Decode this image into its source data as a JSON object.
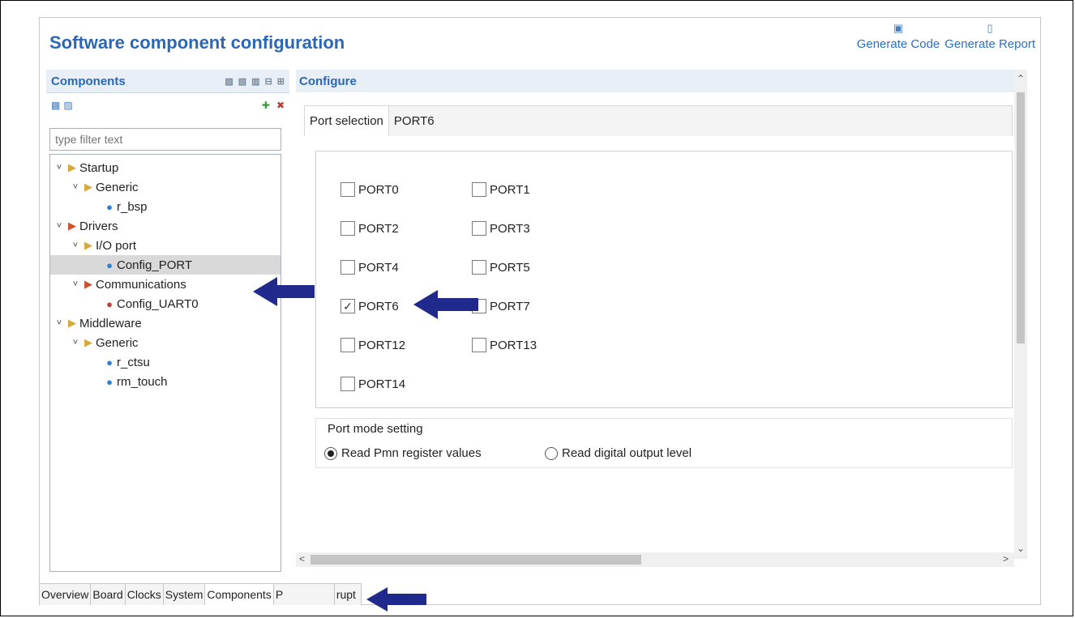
{
  "window": {
    "title": "Software component configuration"
  },
  "header_actions": [
    {
      "label": "Generate Code",
      "icon": "generate-code-icon"
    },
    {
      "label": "Generate Report",
      "icon": "generate-report-icon"
    }
  ],
  "components_panel": {
    "title": "Components",
    "filter_placeholder": "type filter text",
    "tree": [
      {
        "label": "Startup",
        "level": 0,
        "type": "folder"
      },
      {
        "label": "Generic",
        "level": 1,
        "type": "folder"
      },
      {
        "label": "r_bsp",
        "level": 2,
        "type": "component"
      },
      {
        "label": "Drivers",
        "level": 0,
        "type": "folder"
      },
      {
        "label": "I/O port",
        "level": 1,
        "type": "folder"
      },
      {
        "label": "Config_PORT",
        "level": 2,
        "type": "component",
        "selected": true
      },
      {
        "label": "Communications",
        "level": 1,
        "type": "folder"
      },
      {
        "label": "Config_UART0",
        "level": 2,
        "type": "component"
      },
      {
        "label": "Middleware",
        "level": 0,
        "type": "folder"
      },
      {
        "label": "Generic",
        "level": 1,
        "type": "folder"
      },
      {
        "label": "r_ctsu",
        "level": 2,
        "type": "component"
      },
      {
        "label": "rm_touch",
        "level": 2,
        "type": "component"
      }
    ]
  },
  "configure_panel": {
    "title": "Configure",
    "tabs": [
      "Port selection",
      "PORT6"
    ],
    "ports": [
      {
        "label": "PORT0",
        "checked": false
      },
      {
        "label": "PORT1",
        "checked": false
      },
      {
        "label": "PORT2",
        "checked": false
      },
      {
        "label": "PORT3",
        "checked": false
      },
      {
        "label": "PORT4",
        "checked": false
      },
      {
        "label": "PORT5",
        "checked": false
      },
      {
        "label": "PORT6",
        "checked": true
      },
      {
        "label": "PORT7",
        "checked": false
      },
      {
        "label": "PORT12",
        "checked": false
      },
      {
        "label": "PORT13",
        "checked": false
      },
      {
        "label": "PORT14",
        "checked": false
      }
    ],
    "port_mode": {
      "title": "Port mode setting",
      "options": [
        {
          "label": "Read Pmn register values",
          "selected": true
        },
        {
          "label": "Read digital output level",
          "selected": false
        }
      ]
    }
  },
  "bottom_tabs": [
    "Overview",
    "Board",
    "Clocks",
    "System",
    "Components",
    "P",
    "rupt"
  ],
  "colors": {
    "accent": "#2b67b6",
    "arrow": "#1f2a8c"
  }
}
